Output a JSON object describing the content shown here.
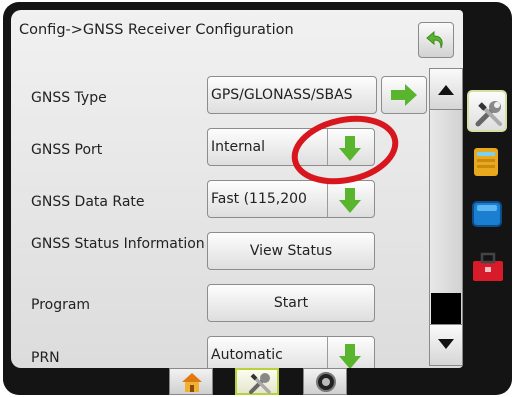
{
  "header": {
    "title": "Config->GNSS Receiver Configuration",
    "back_icon": "back-arrow-icon"
  },
  "rows": [
    {
      "label": "GNSS Type",
      "value": "GPS/GLONASS/SBAS",
      "control": "next-arrow"
    },
    {
      "label": "GNSS Port",
      "value": "Internal",
      "control": "dropdown-arrow"
    },
    {
      "label": "GNSS Data Rate",
      "value": "Fast (115,200",
      "control": "dropdown-arrow"
    },
    {
      "label": "GNSS Status Information",
      "value": "View Status",
      "control": "button"
    },
    {
      "label": "Program",
      "value": "Start",
      "control": "button"
    },
    {
      "label": "PRN",
      "value": "Automatic",
      "control": "dropdown-arrow"
    }
  ],
  "side_tabs": [
    "tools-icon",
    "console-icon",
    "display-icon",
    "toolbox-icon"
  ],
  "bottom_tabs": [
    "home-icon",
    "tools-icon",
    "gauge-icon"
  ],
  "colors": {
    "arrow_green": "#5ab52e",
    "highlight_red": "#d8161d",
    "active_tab_border": "#b8d23c"
  }
}
